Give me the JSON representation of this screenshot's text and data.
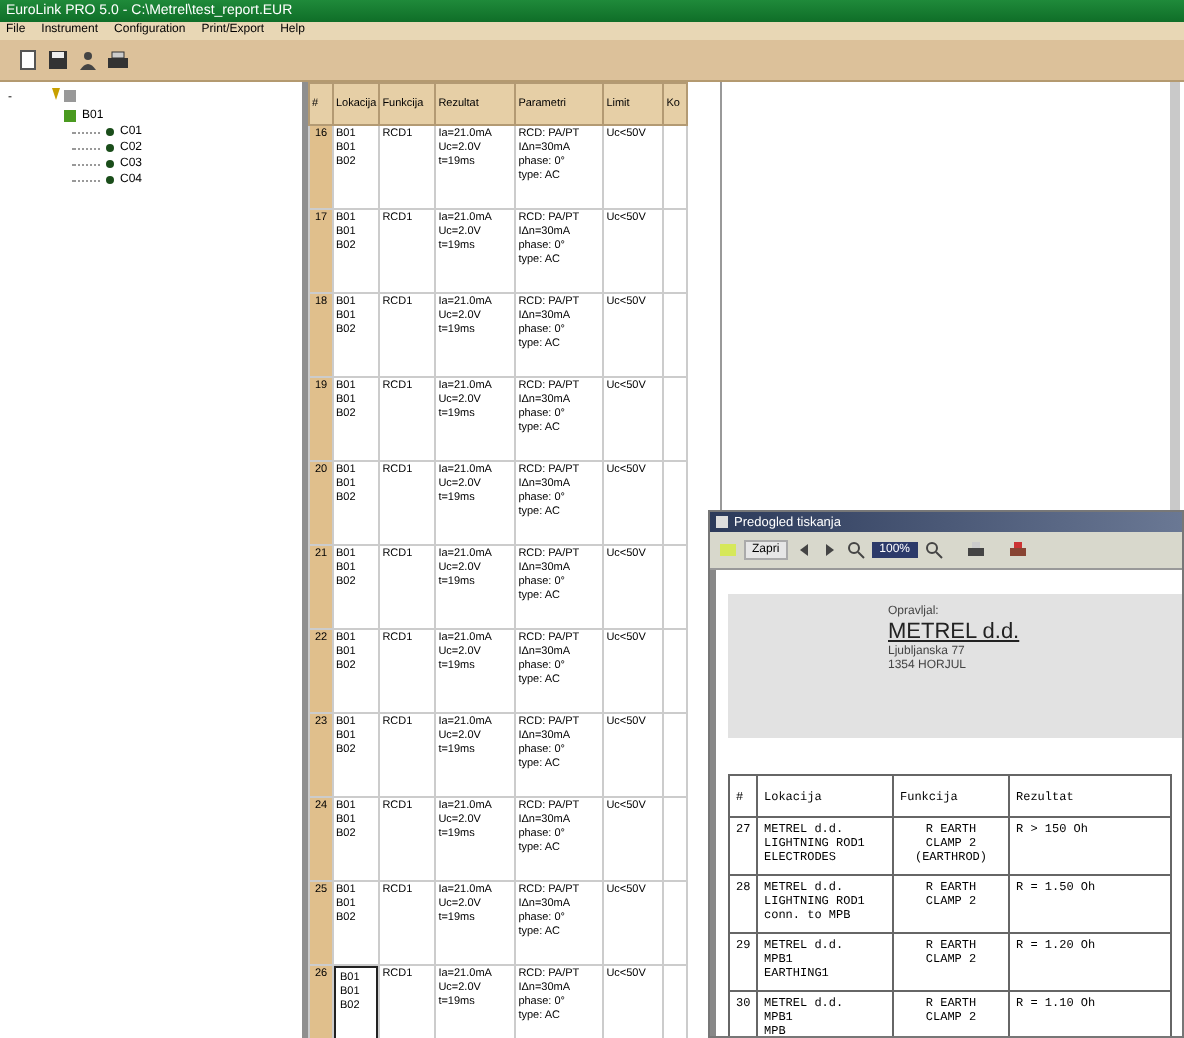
{
  "window": {
    "title": "EuroLink PRO 5.0 - C:\\Metrel\\test_report.EUR"
  },
  "menu": [
    "File",
    "Instrument",
    "Configuration",
    "Print/Export",
    "Help"
  ],
  "tree": {
    "label": "-",
    "children": [
      {
        "label": "B01",
        "expanded": true,
        "children": [
          {
            "label": "C01"
          },
          {
            "label": "C02"
          },
          {
            "label": "C03"
          },
          {
            "label": "C04"
          }
        ]
      }
    ]
  },
  "table": {
    "columns": [
      "#",
      "Lokacija",
      "Funkcija",
      "Rezultat",
      "Parametri",
      "Limit",
      "Ko"
    ],
    "rows": [
      {
        "num": "16",
        "location": [
          "B01",
          "B01",
          "B02"
        ],
        "function": "RCD1",
        "result": [
          "Ia=21.0mA",
          "Uc=2.0V",
          "t=19ms"
        ],
        "params": [
          "RCD: PA/PT",
          "IΔn=30mA",
          "phase: 0°",
          "type: AC"
        ],
        "limit": "Uc<50V",
        "selected": false
      },
      {
        "num": "17",
        "location": [
          "B01",
          "B01",
          "B02"
        ],
        "function": "RCD1",
        "result": [
          "Ia=21.0mA",
          "Uc=2.0V",
          "t=19ms"
        ],
        "params": [
          "RCD: PA/PT",
          "IΔn=30mA",
          "phase: 0°",
          "type: AC"
        ],
        "limit": "Uc<50V",
        "selected": false
      },
      {
        "num": "18",
        "location": [
          "B01",
          "B01",
          "B02"
        ],
        "function": "RCD1",
        "result": [
          "Ia=21.0mA",
          "Uc=2.0V",
          "t=19ms"
        ],
        "params": [
          "RCD: PA/PT",
          "IΔn=30mA",
          "phase: 0°",
          "type: AC"
        ],
        "limit": "Uc<50V",
        "selected": false
      },
      {
        "num": "19",
        "location": [
          "B01",
          "B01",
          "B02"
        ],
        "function": "RCD1",
        "result": [
          "Ia=21.0mA",
          "Uc=2.0V",
          "t=19ms"
        ],
        "params": [
          "RCD: PA/PT",
          "IΔn=30mA",
          "phase: 0°",
          "type: AC"
        ],
        "limit": "Uc<50V",
        "selected": false
      },
      {
        "num": "20",
        "location": [
          "B01",
          "B01",
          "B02"
        ],
        "function": "RCD1",
        "result": [
          "Ia=21.0mA",
          "Uc=2.0V",
          "t=19ms"
        ],
        "params": [
          "RCD: PA/PT",
          "IΔn=30mA",
          "phase: 0°",
          "type: AC"
        ],
        "limit": "Uc<50V",
        "selected": false
      },
      {
        "num": "21",
        "location": [
          "B01",
          "B01",
          "B02"
        ],
        "function": "RCD1",
        "result": [
          "Ia=21.0mA",
          "Uc=2.0V",
          "t=19ms"
        ],
        "params": [
          "RCD: PA/PT",
          "IΔn=30mA",
          "phase: 0°",
          "type: AC"
        ],
        "limit": "Uc<50V",
        "selected": false
      },
      {
        "num": "22",
        "location": [
          "B01",
          "B01",
          "B02"
        ],
        "function": "RCD1",
        "result": [
          "Ia=21.0mA",
          "Uc=2.0V",
          "t=19ms"
        ],
        "params": [
          "RCD: PA/PT",
          "IΔn=30mA",
          "phase: 0°",
          "type: AC"
        ],
        "limit": "Uc<50V",
        "selected": false
      },
      {
        "num": "23",
        "location": [
          "B01",
          "B01",
          "B02"
        ],
        "function": "RCD1",
        "result": [
          "Ia=21.0mA",
          "Uc=2.0V",
          "t=19ms"
        ],
        "params": [
          "RCD: PA/PT",
          "IΔn=30mA",
          "phase: 0°",
          "type: AC"
        ],
        "limit": "Uc<50V",
        "selected": false
      },
      {
        "num": "24",
        "location": [
          "B01",
          "B01",
          "B02"
        ],
        "function": "RCD1",
        "result": [
          "Ia=21.0mA",
          "Uc=2.0V",
          "t=19ms"
        ],
        "params": [
          "RCD: PA/PT",
          "IΔn=30mA",
          "phase: 0°",
          "type: AC"
        ],
        "limit": "Uc<50V",
        "selected": false
      },
      {
        "num": "25",
        "location": [
          "B01",
          "B01",
          "B02"
        ],
        "function": "RCD1",
        "result": [
          "Ia=21.0mA",
          "Uc=2.0V",
          "t=19ms"
        ],
        "params": [
          "RCD: PA/PT",
          "IΔn=30mA",
          "phase: 0°",
          "type: AC"
        ],
        "limit": "Uc<50V",
        "selected": false
      },
      {
        "num": "26",
        "location": [
          "B01",
          "B01",
          "B02"
        ],
        "function": "RCD1",
        "result": [
          "Ia=21.0mA",
          "Uc=2.0V",
          "t=19ms"
        ],
        "params": [
          "RCD: PA/PT",
          "IΔn=30mA",
          "phase: 0°",
          "type: AC"
        ],
        "limit": "Uc<50V",
        "selected": true
      }
    ]
  },
  "preview": {
    "title": "Predogled tiskanja",
    "close_button": "Zapri",
    "zoom": "100%",
    "company": {
      "label": "Opravljal:",
      "name": "METREL d.d.",
      "street": "Ljubljanska 77",
      "city": "1354 HORJUL"
    },
    "columns": [
      "#",
      "Lokacija",
      "Funkcija",
      "Rezultat"
    ],
    "rows": [
      {
        "num": "27",
        "location": [
          "METREL d.d.",
          "LIGHTNING ROD1",
          "ELECTRODES"
        ],
        "function": [
          "R EARTH",
          "CLAMP 2",
          "(EARTHROD)"
        ],
        "result": "R > 150 Oh"
      },
      {
        "num": "28",
        "location": [
          "METREL d.d.",
          "LIGHTNING ROD1",
          "conn. to MPB"
        ],
        "function": [
          "R EARTH",
          "CLAMP 2"
        ],
        "result": "R = 1.50 Oh"
      },
      {
        "num": "29",
        "location": [
          "METREL d.d.",
          "MPB1",
          "EARTHING1"
        ],
        "function": [
          "R EARTH",
          "CLAMP 2"
        ],
        "result": "R = 1.20 Oh"
      },
      {
        "num": "30",
        "location": [
          "METREL d.d.",
          "MPB1",
          "MPB"
        ],
        "function": [
          "R EARTH",
          "CLAMP 2"
        ],
        "result": "R = 1.10 Oh"
      }
    ]
  }
}
